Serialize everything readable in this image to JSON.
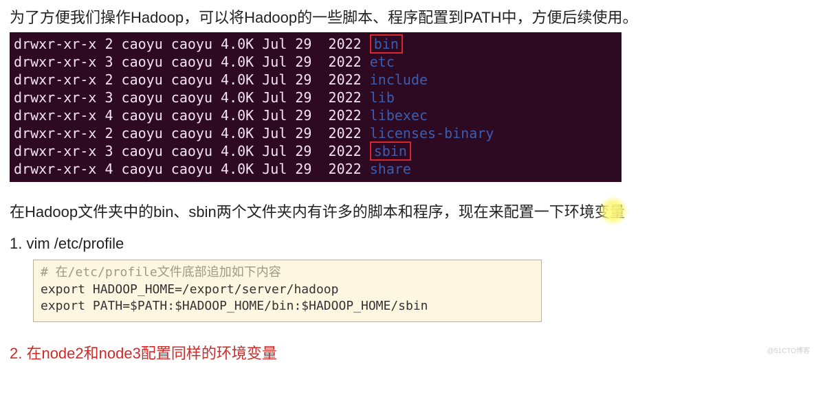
{
  "intro": "为了方便我们操作Hadoop，可以将Hadoop的一些脚本、程序配置到PATH中，方便后续使用。",
  "ls_entries": [
    {
      "perm": "drwxr-xr-x",
      "links": "2",
      "owner": "caoyu",
      "group": "caoyu",
      "size": "4.0K",
      "month": "Jul",
      "day": "29",
      "year": "2022",
      "name": "bin",
      "highlight": true
    },
    {
      "perm": "drwxr-xr-x",
      "links": "3",
      "owner": "caoyu",
      "group": "caoyu",
      "size": "4.0K",
      "month": "Jul",
      "day": "29",
      "year": "2022",
      "name": "etc",
      "highlight": false
    },
    {
      "perm": "drwxr-xr-x",
      "links": "2",
      "owner": "caoyu",
      "group": "caoyu",
      "size": "4.0K",
      "month": "Jul",
      "day": "29",
      "year": "2022",
      "name": "include",
      "highlight": false
    },
    {
      "perm": "drwxr-xr-x",
      "links": "3",
      "owner": "caoyu",
      "group": "caoyu",
      "size": "4.0K",
      "month": "Jul",
      "day": "29",
      "year": "2022",
      "name": "lib",
      "highlight": false
    },
    {
      "perm": "drwxr-xr-x",
      "links": "4",
      "owner": "caoyu",
      "group": "caoyu",
      "size": "4.0K",
      "month": "Jul",
      "day": "29",
      "year": "2022",
      "name": "libexec",
      "highlight": false
    },
    {
      "perm": "drwxr-xr-x",
      "links": "2",
      "owner": "caoyu",
      "group": "caoyu",
      "size": "4.0K",
      "month": "Jul",
      "day": "29",
      "year": "2022",
      "name": "licenses-binary",
      "highlight": false
    },
    {
      "perm": "drwxr-xr-x",
      "links": "3",
      "owner": "caoyu",
      "group": "caoyu",
      "size": "4.0K",
      "month": "Jul",
      "day": "29",
      "year": "2022",
      "name": "sbin",
      "highlight": true
    },
    {
      "perm": "drwxr-xr-x",
      "links": "4",
      "owner": "caoyu",
      "group": "caoyu",
      "size": "4.0K",
      "month": "Jul",
      "day": "29",
      "year": "2022",
      "name": "share",
      "highlight": false
    }
  ],
  "mid": "在Hadoop文件夹中的bin、sbin两个文件夹内有许多的脚本和程序，现在来配置一下环境变量",
  "step1": "1. vim /etc/profile",
  "code": {
    "comment": "# 在/etc/profile文件底部追加如下内容",
    "line1": "export HADOOP_HOME=/export/server/hadoop",
    "line2": "export PATH=$PATH:$HADOOP_HOME/bin:$HADOOP_HOME/sbin"
  },
  "step2": "2. 在node2和node3配置同样的环境变量",
  "watermark": "@51CTO博客"
}
